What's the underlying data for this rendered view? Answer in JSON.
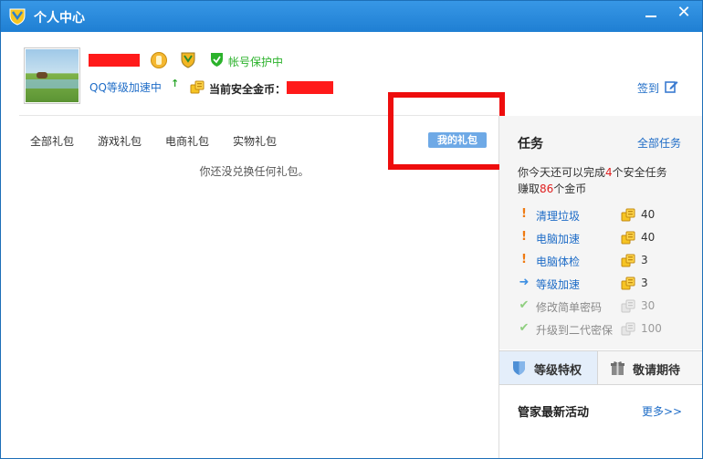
{
  "window": {
    "title": "个人中心",
    "minimize_glyph": "",
    "close_glyph": "✕"
  },
  "profile": {
    "nickname_visible_tail": "",
    "protection_status": "帐号保护中",
    "speed_link": "QQ等级加速中",
    "coin_label": "当前安全金币：",
    "signin_label": "签到"
  },
  "gifts": {
    "tabs": [
      "全部礼包",
      "游戏礼包",
      "电商礼包",
      "实物礼包"
    ],
    "my_gifts_label": "我的礼包",
    "empty_message": "你还没兑换任何礼包。"
  },
  "tasks": {
    "title": "任务",
    "all_link": "全部任务",
    "summary_prefix": "你今天还可以完成",
    "summary_count": "4",
    "summary_suffix": "个安全任务",
    "earn_prefix": "赚取",
    "earn_count": "86",
    "earn_suffix": "个金币",
    "items": [
      {
        "name": "清理垃圾",
        "coins": "40",
        "status": "pending"
      },
      {
        "name": "电脑加速",
        "coins": "40",
        "status": "pending"
      },
      {
        "name": "电脑体检",
        "coins": "3",
        "status": "pending"
      },
      {
        "name": "等级加速",
        "coins": "3",
        "status": "arrow"
      },
      {
        "name": "修改简单密码",
        "coins": "30",
        "status": "done"
      },
      {
        "name": "升级到二代密保",
        "coins": "100",
        "status": "done"
      }
    ]
  },
  "privileges": {
    "tab_level": "等级特权",
    "tab_coming": "敬请期待"
  },
  "news": {
    "title": "管家最新活动",
    "more_link": "更多>>"
  },
  "colors": {
    "titlebar": "#2a8ae0",
    "link": "#1e6cc7",
    "protect_green": "#2bb22b",
    "highlight_red": "#ee0d0d",
    "my_gift_blue": "#6ea9e6"
  }
}
